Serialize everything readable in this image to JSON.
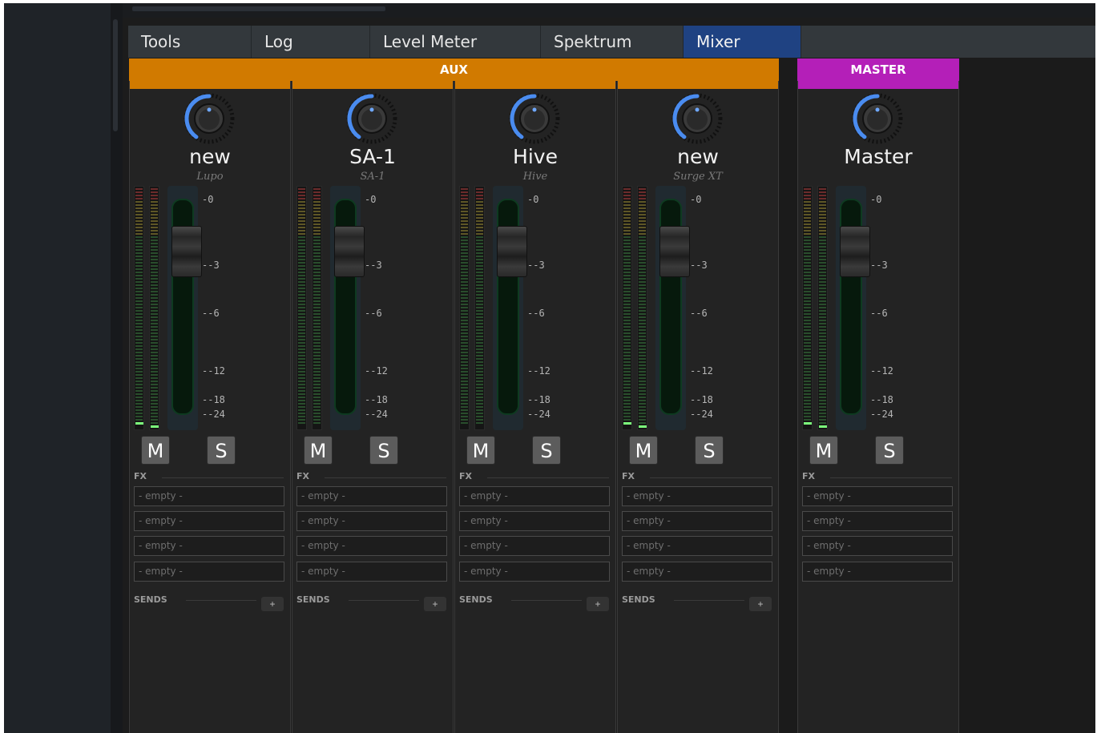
{
  "tabs": [
    {
      "label": "Tools",
      "width": 154,
      "active": false
    },
    {
      "label": "Log",
      "width": 148,
      "active": false
    },
    {
      "label": "Level Meter",
      "width": 213,
      "active": false
    },
    {
      "label": "Spektrum",
      "width": 178,
      "active": false
    },
    {
      "label": "Mixer",
      "width": 147,
      "active": true
    }
  ],
  "groups": {
    "aux_label": "AUX",
    "master_label": "MASTER",
    "aux_color": "#d17a00",
    "master_color": "#b41fb8"
  },
  "strips": [
    {
      "name": "new",
      "plugin": "Lupo",
      "group": "aux",
      "peaks": [
        "left",
        "right"
      ]
    },
    {
      "name": "SA-1",
      "plugin": "SA-1",
      "group": "aux",
      "peaks": []
    },
    {
      "name": "Hive",
      "plugin": "Hive",
      "group": "aux",
      "peaks": []
    },
    {
      "name": "new",
      "plugin": "Surge XT",
      "group": "aux",
      "peaks": [
        "left",
        "right"
      ]
    },
    {
      "name": "Master",
      "plugin": "",
      "group": "master",
      "peaks": [
        "left",
        "right"
      ]
    }
  ],
  "db_scale": [
    "-0",
    "--3",
    "--6",
    "--12",
    "--18",
    "--24"
  ],
  "buttons": {
    "mute": "M",
    "solo": "S"
  },
  "fx_label": "FX",
  "fx_slot_text": "- empty -",
  "fx_slot_count": 4,
  "sends_label": "SENDS",
  "sends_add_label": "+"
}
